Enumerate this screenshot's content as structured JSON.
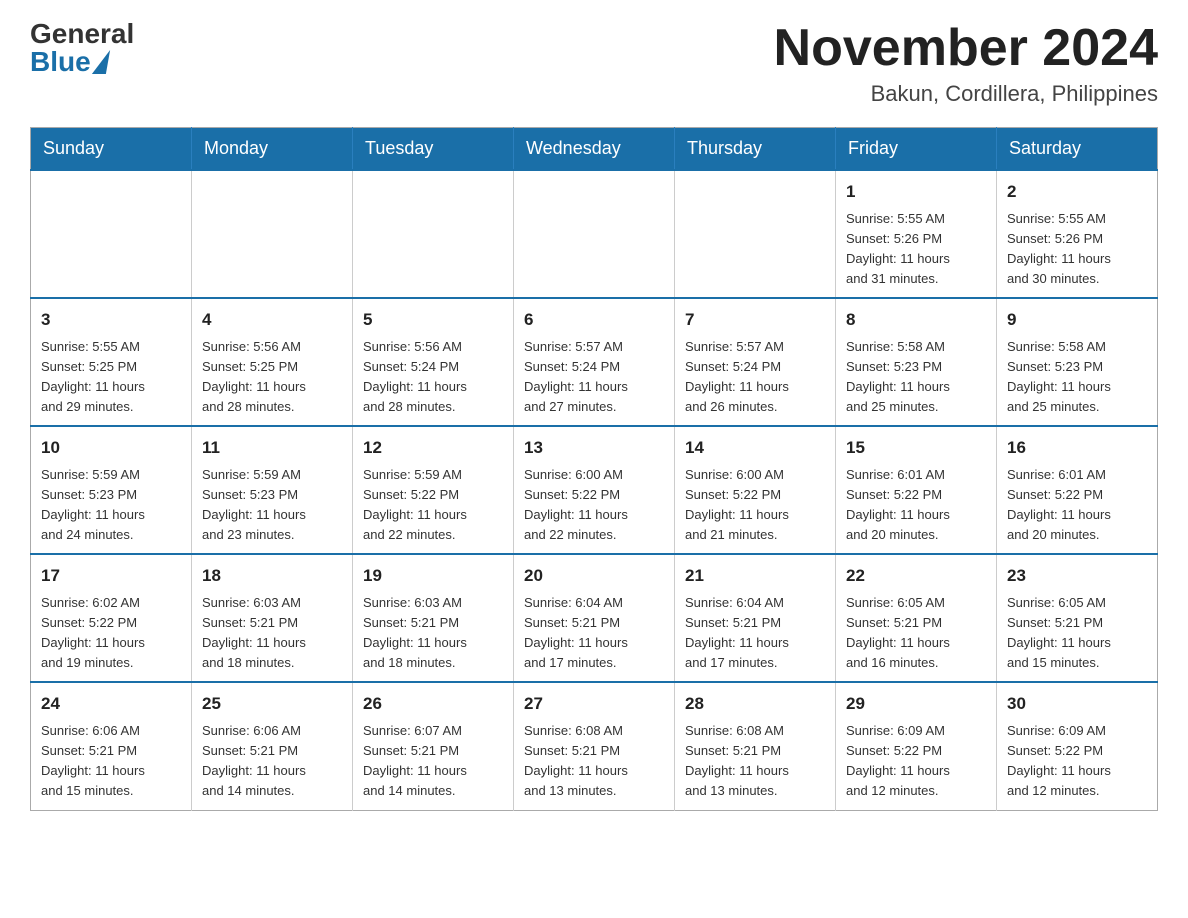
{
  "logo": {
    "general": "General",
    "blue": "Blue"
  },
  "title": "November 2024",
  "location": "Bakun, Cordillera, Philippines",
  "days_of_week": [
    "Sunday",
    "Monday",
    "Tuesday",
    "Wednesday",
    "Thursday",
    "Friday",
    "Saturday"
  ],
  "weeks": [
    [
      {
        "day": "",
        "info": ""
      },
      {
        "day": "",
        "info": ""
      },
      {
        "day": "",
        "info": ""
      },
      {
        "day": "",
        "info": ""
      },
      {
        "day": "",
        "info": ""
      },
      {
        "day": "1",
        "info": "Sunrise: 5:55 AM\nSunset: 5:26 PM\nDaylight: 11 hours\nand 31 minutes."
      },
      {
        "day": "2",
        "info": "Sunrise: 5:55 AM\nSunset: 5:26 PM\nDaylight: 11 hours\nand 30 minutes."
      }
    ],
    [
      {
        "day": "3",
        "info": "Sunrise: 5:55 AM\nSunset: 5:25 PM\nDaylight: 11 hours\nand 29 minutes."
      },
      {
        "day": "4",
        "info": "Sunrise: 5:56 AM\nSunset: 5:25 PM\nDaylight: 11 hours\nand 28 minutes."
      },
      {
        "day": "5",
        "info": "Sunrise: 5:56 AM\nSunset: 5:24 PM\nDaylight: 11 hours\nand 28 minutes."
      },
      {
        "day": "6",
        "info": "Sunrise: 5:57 AM\nSunset: 5:24 PM\nDaylight: 11 hours\nand 27 minutes."
      },
      {
        "day": "7",
        "info": "Sunrise: 5:57 AM\nSunset: 5:24 PM\nDaylight: 11 hours\nand 26 minutes."
      },
      {
        "day": "8",
        "info": "Sunrise: 5:58 AM\nSunset: 5:23 PM\nDaylight: 11 hours\nand 25 minutes."
      },
      {
        "day": "9",
        "info": "Sunrise: 5:58 AM\nSunset: 5:23 PM\nDaylight: 11 hours\nand 25 minutes."
      }
    ],
    [
      {
        "day": "10",
        "info": "Sunrise: 5:59 AM\nSunset: 5:23 PM\nDaylight: 11 hours\nand 24 minutes."
      },
      {
        "day": "11",
        "info": "Sunrise: 5:59 AM\nSunset: 5:23 PM\nDaylight: 11 hours\nand 23 minutes."
      },
      {
        "day": "12",
        "info": "Sunrise: 5:59 AM\nSunset: 5:22 PM\nDaylight: 11 hours\nand 22 minutes."
      },
      {
        "day": "13",
        "info": "Sunrise: 6:00 AM\nSunset: 5:22 PM\nDaylight: 11 hours\nand 22 minutes."
      },
      {
        "day": "14",
        "info": "Sunrise: 6:00 AM\nSunset: 5:22 PM\nDaylight: 11 hours\nand 21 minutes."
      },
      {
        "day": "15",
        "info": "Sunrise: 6:01 AM\nSunset: 5:22 PM\nDaylight: 11 hours\nand 20 minutes."
      },
      {
        "day": "16",
        "info": "Sunrise: 6:01 AM\nSunset: 5:22 PM\nDaylight: 11 hours\nand 20 minutes."
      }
    ],
    [
      {
        "day": "17",
        "info": "Sunrise: 6:02 AM\nSunset: 5:22 PM\nDaylight: 11 hours\nand 19 minutes."
      },
      {
        "day": "18",
        "info": "Sunrise: 6:03 AM\nSunset: 5:21 PM\nDaylight: 11 hours\nand 18 minutes."
      },
      {
        "day": "19",
        "info": "Sunrise: 6:03 AM\nSunset: 5:21 PM\nDaylight: 11 hours\nand 18 minutes."
      },
      {
        "day": "20",
        "info": "Sunrise: 6:04 AM\nSunset: 5:21 PM\nDaylight: 11 hours\nand 17 minutes."
      },
      {
        "day": "21",
        "info": "Sunrise: 6:04 AM\nSunset: 5:21 PM\nDaylight: 11 hours\nand 17 minutes."
      },
      {
        "day": "22",
        "info": "Sunrise: 6:05 AM\nSunset: 5:21 PM\nDaylight: 11 hours\nand 16 minutes."
      },
      {
        "day": "23",
        "info": "Sunrise: 6:05 AM\nSunset: 5:21 PM\nDaylight: 11 hours\nand 15 minutes."
      }
    ],
    [
      {
        "day": "24",
        "info": "Sunrise: 6:06 AM\nSunset: 5:21 PM\nDaylight: 11 hours\nand 15 minutes."
      },
      {
        "day": "25",
        "info": "Sunrise: 6:06 AM\nSunset: 5:21 PM\nDaylight: 11 hours\nand 14 minutes."
      },
      {
        "day": "26",
        "info": "Sunrise: 6:07 AM\nSunset: 5:21 PM\nDaylight: 11 hours\nand 14 minutes."
      },
      {
        "day": "27",
        "info": "Sunrise: 6:08 AM\nSunset: 5:21 PM\nDaylight: 11 hours\nand 13 minutes."
      },
      {
        "day": "28",
        "info": "Sunrise: 6:08 AM\nSunset: 5:21 PM\nDaylight: 11 hours\nand 13 minutes."
      },
      {
        "day": "29",
        "info": "Sunrise: 6:09 AM\nSunset: 5:22 PM\nDaylight: 11 hours\nand 12 minutes."
      },
      {
        "day": "30",
        "info": "Sunrise: 6:09 AM\nSunset: 5:22 PM\nDaylight: 11 hours\nand 12 minutes."
      }
    ]
  ]
}
